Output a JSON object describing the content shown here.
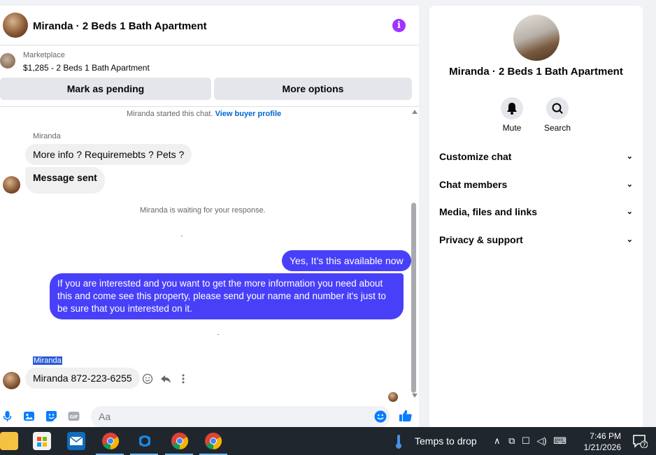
{
  "header": {
    "title": "Miranda · 2 Beds 1 Bath Apartment",
    "info_icon": "i"
  },
  "listing": {
    "source": "Marketplace",
    "title": "$1,285 - 2 Beds 1 Bath Apartment"
  },
  "actions": {
    "pending": "Mark as pending",
    "more": "More options"
  },
  "messages": {
    "started_prefix": "Miranda started this chat.",
    "buyer_link": "View buyer profile",
    "sender_1": "Miranda",
    "msg_1": "More info ? Requiremebts ? Pets ?",
    "msg_2": "Message sent",
    "waiting": "Miranda is waiting for your response.",
    "msg_3": "Yes, It’s this available now",
    "msg_4": "If you are interested and you want to get the more information you need about this and come see this property, please send your name and number it's just to be sure that you interested on it.",
    "sender_2": "Miranda",
    "msg_5": "Miranda 872-223-6255"
  },
  "composer": {
    "placeholder": "Aa"
  },
  "info_panel": {
    "title": "Miranda · 2 Beds 1 Bath Apartment",
    "mute_label": "Mute",
    "search_label": "Search",
    "sections": [
      "Customize chat",
      "Chat members",
      "Media, files and links",
      "Privacy & support"
    ]
  },
  "taskbar": {
    "weather": "Temps to drop",
    "time": "7:46 PM",
    "date": "1/21/2026",
    "notif_count": "7",
    "apps": [
      "file-explorer-icon",
      "microsoft-store-icon",
      "mail-icon",
      "chrome-icon",
      "browser-icon",
      "chrome-icon",
      "chrome-icon"
    ]
  },
  "colors": {
    "accent": "#4840f9",
    "link": "#0064d1",
    "info": "#a033ff",
    "taskbar": "#20262d"
  }
}
